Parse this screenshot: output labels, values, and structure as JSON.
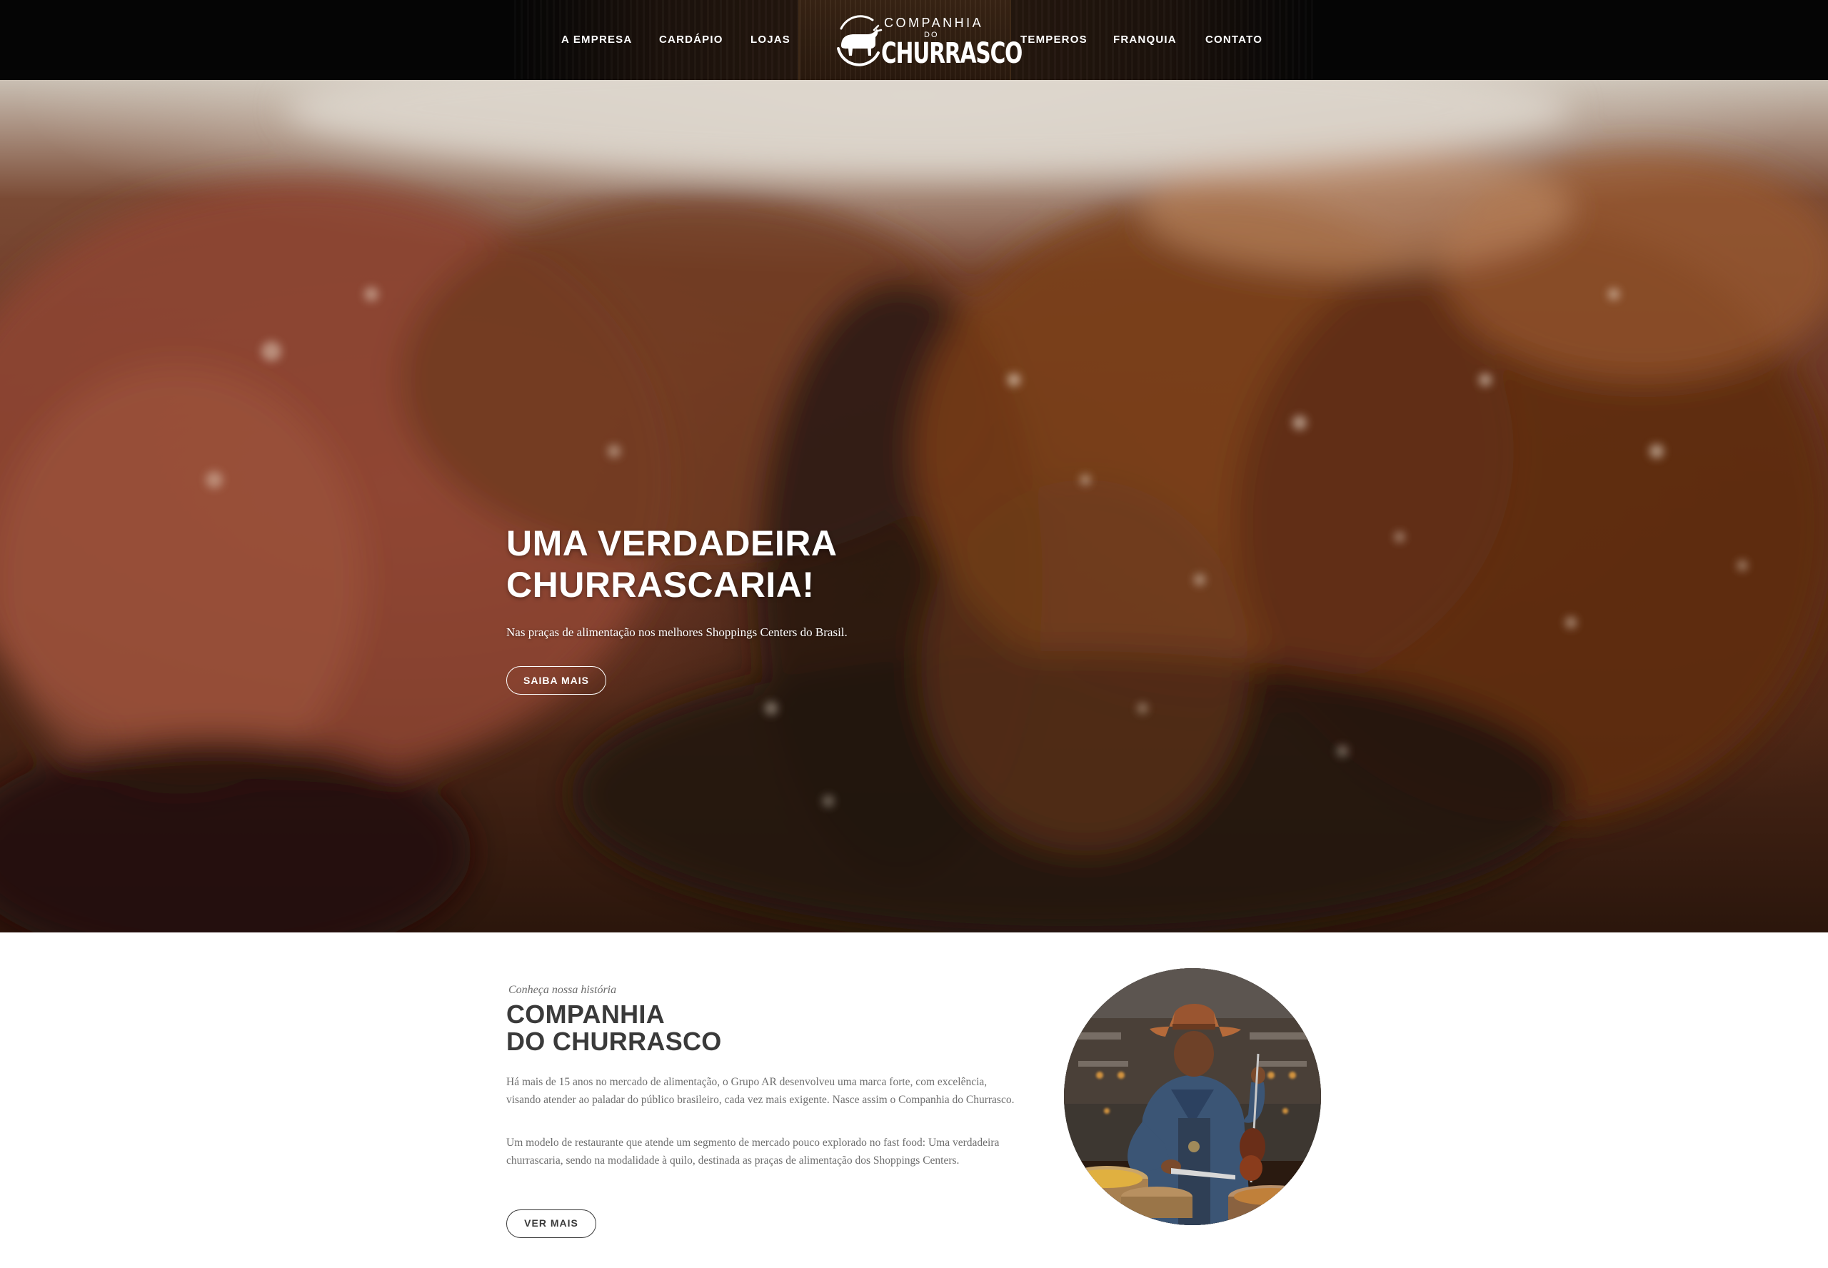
{
  "nav": {
    "left_items": [
      {
        "label": "A EMPRESA"
      },
      {
        "label": "CARDÁPIO"
      },
      {
        "label": "LOJAS"
      }
    ],
    "right_items": [
      {
        "label": "TEMPEROS"
      },
      {
        "label": "FRANQUIA"
      },
      {
        "label": "CONTATO"
      }
    ],
    "logo": {
      "line1": "COMPANHIA",
      "line2": "DO",
      "line3": "CHURRASCO",
      "icon": "bull-icon"
    }
  },
  "hero": {
    "title_line1": "UMA VERDADEIRA",
    "title_line2": "CHURRASCARIA!",
    "subtitle": "Nas praças de alimentação nos melhores Shoppings Centers do Brasil.",
    "button_label": "SAIBA MAIS"
  },
  "about": {
    "kicker": "Conheça nossa história",
    "title_line1": "COMPANHIA",
    "title_line2": "DO CHURRASCO",
    "paragraph1": "Há mais de 15 anos no mercado de alimentação, o Grupo AR desenvolveu uma marca forte, com excelência, visando atender ao paladar do público brasileiro, cada vez mais exigente. Nasce assim o Companhia do Churrasco.",
    "paragraph2": "Um modelo de restaurante que atende um segmento de mercado pouco explorado no fast food: Uma verdadeira churrascaria, sendo na modalidade à quilo, destinada as praças de alimentação dos Shoppings Centers.",
    "button_label": "VER MAIS"
  },
  "colors": {
    "nav_background": "#050505",
    "wood": "#2b1a0e",
    "heading_dark": "#3a3a3a",
    "body_text": "#6e6e6e"
  }
}
